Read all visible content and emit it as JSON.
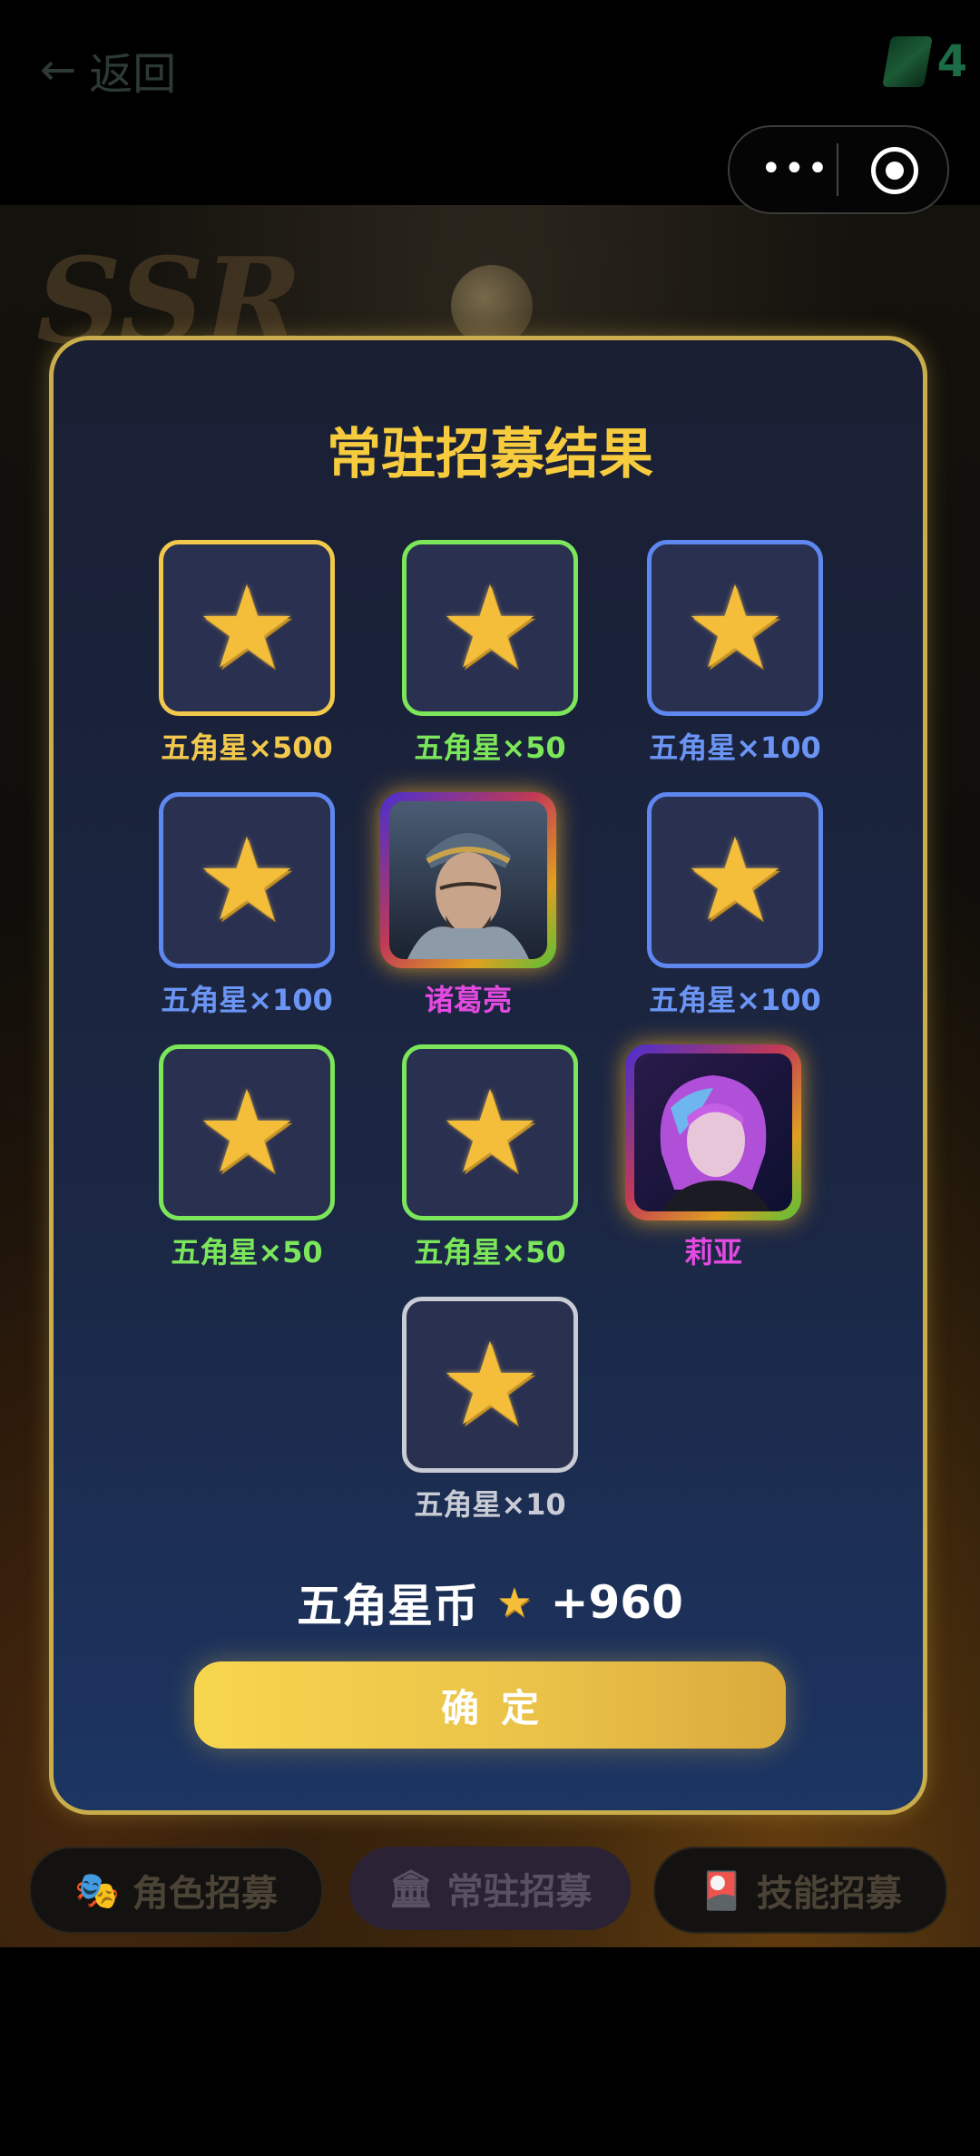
{
  "topbar": {
    "back_label": "返回",
    "currency_value": "4"
  },
  "background": {
    "ssr_text": "SSR"
  },
  "tabs": [
    {
      "icon": "drama-mask-icon",
      "label": "角色招募"
    },
    {
      "icon": "temple-icon",
      "label": "常驻招募"
    },
    {
      "icon": "card-icon",
      "label": "技能招募"
    }
  ],
  "modal": {
    "title": "常驻招募结果",
    "rewards": [
      {
        "type": "star",
        "label": "五角星×500",
        "rarity": "gold"
      },
      {
        "type": "star",
        "label": "五角星×50",
        "rarity": "green"
      },
      {
        "type": "star",
        "label": "五角星×100",
        "rarity": "blue"
      },
      {
        "type": "star",
        "label": "五角星×100",
        "rarity": "blue"
      },
      {
        "type": "character",
        "label": "诸葛亮",
        "rarity": "ssr"
      },
      {
        "type": "star",
        "label": "五角星×100",
        "rarity": "blue"
      },
      {
        "type": "star",
        "label": "五角星×50",
        "rarity": "green"
      },
      {
        "type": "star",
        "label": "五角星×50",
        "rarity": "green"
      },
      {
        "type": "character",
        "label": "莉亚",
        "rarity": "ssr"
      },
      {
        "type": "star",
        "label": "五角星×10",
        "rarity": "white"
      }
    ],
    "summary_label": "五角星币",
    "summary_value": "+960",
    "confirm_label": "确定"
  },
  "colors": {
    "gold": "#f2c94c",
    "green": "#7be65a",
    "blue": "#5e88f0",
    "white": "#c9ccd4",
    "ssr_label": "#e34ae0",
    "title": "#f6cc3e"
  }
}
